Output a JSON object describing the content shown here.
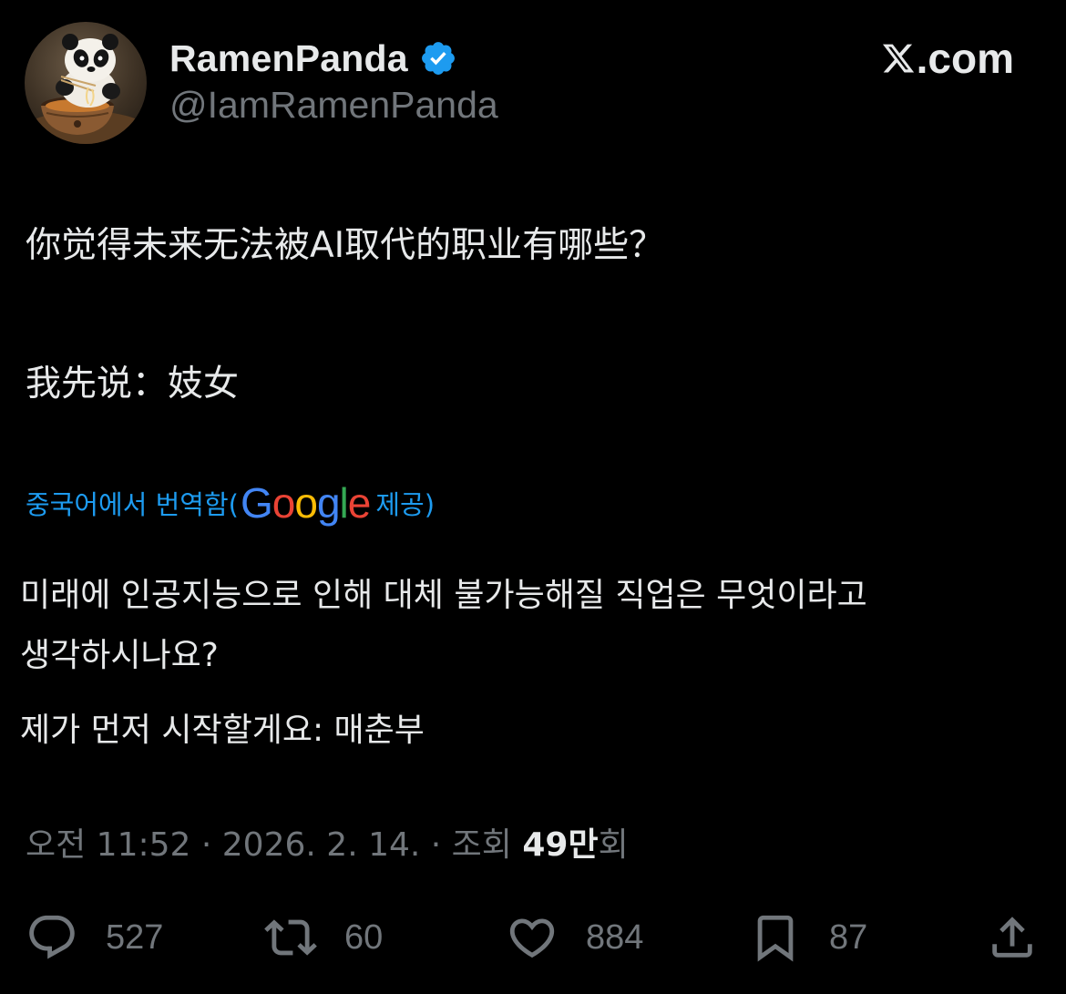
{
  "header": {
    "display_name": "RamenPanda",
    "handle": "@IamRamenPanda",
    "verified": true,
    "site_logo_text": ".com",
    "avatar_icon": "panda-eating-ramen-avatar"
  },
  "post": {
    "original_text": [
      "你觉得未来无法被AI取代的职业有哪些？",
      "我先说：妓女"
    ],
    "translation_label": "중국어에서 번역함(",
    "translation_provider": "Google",
    "translation_suffix": " 제공)",
    "translated_text": [
      "미래에 인공지능으로 인해 대체 불가능해질 직업은 무엇이라고",
      "생각하시나요?",
      "제가 먼저 시작할게요: 매춘부"
    ]
  },
  "meta": {
    "time": "오전 11:52",
    "separator": " · ",
    "date": "2026. 2. 14.",
    "views_label": "조회 ",
    "views_count": "49만",
    "views_suffix": "회"
  },
  "actions": {
    "reply_count": "527",
    "repost_count": "60",
    "like_count": "884",
    "bookmark_count": "87"
  },
  "colors": {
    "background": "#000000",
    "text_primary": "#e7e9ea",
    "text_secondary": "#71767b",
    "link": "#1d9bf0",
    "verified_badge": "#1d9bf0"
  }
}
